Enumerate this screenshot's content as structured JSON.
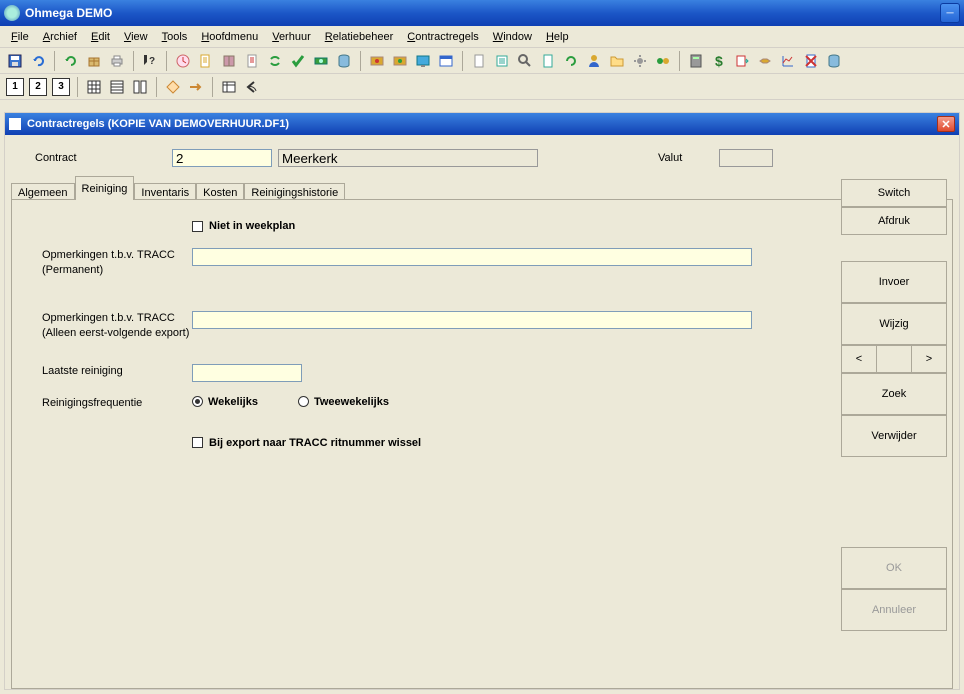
{
  "app": {
    "title": "Ohmega DEMO"
  },
  "menus": [
    {
      "hot": "F",
      "rest": "ile"
    },
    {
      "hot": "A",
      "rest": "rchief"
    },
    {
      "hot": "E",
      "rest": "dit"
    },
    {
      "hot": "V",
      "rest": "iew"
    },
    {
      "hot": "T",
      "rest": "ools"
    },
    {
      "hot": "H",
      "rest": "oofdmenu"
    },
    {
      "hot": "V",
      "rest": "erhuur"
    },
    {
      "hot": "R",
      "rest": "elatiebeheer"
    },
    {
      "hot": "C",
      "rest": "ontractregels"
    },
    {
      "hot": "W",
      "rest": "indow"
    },
    {
      "hot": "H",
      "rest": "elp"
    }
  ],
  "subwindow": {
    "title": "Contractregels (KOPIE VAN DEMOVERHUUR.DF1)"
  },
  "form": {
    "contract_label": "Contract",
    "contract_num": "2",
    "contract_name": "Meerkerk",
    "valut_label": "Valut",
    "valut_value": ""
  },
  "tabs": [
    "Algemeen",
    "Reiniging",
    "Inventaris",
    "Kosten",
    "Reinigingshistorie"
  ],
  "panel": {
    "niet_weekplan": "Niet in weekplan",
    "opm_permanent": "Opmerkingen t.b.v. TRACC (Permanent)",
    "opm_eerst": "Opmerkingen t.b.v. TRACC (Alleen eerst-volgende export)",
    "laatste": "Laatste reiniging",
    "freq_label": "Reinigingsfrequentie",
    "wekelijks": "Wekelijks",
    "tweewekelijks": "Tweewekelijks",
    "export_wissel": "Bij export naar TRACC ritnummer wissel"
  },
  "buttons": {
    "switch": "Switch",
    "afdruk": "Afdruk",
    "invoer": "Invoer",
    "wijzig": "Wijzig",
    "prev": "<",
    "next": ">",
    "zoek": "Zoek",
    "verwijder": "Verwijder",
    "ok": "OK",
    "annuleer": "Annuleer"
  }
}
